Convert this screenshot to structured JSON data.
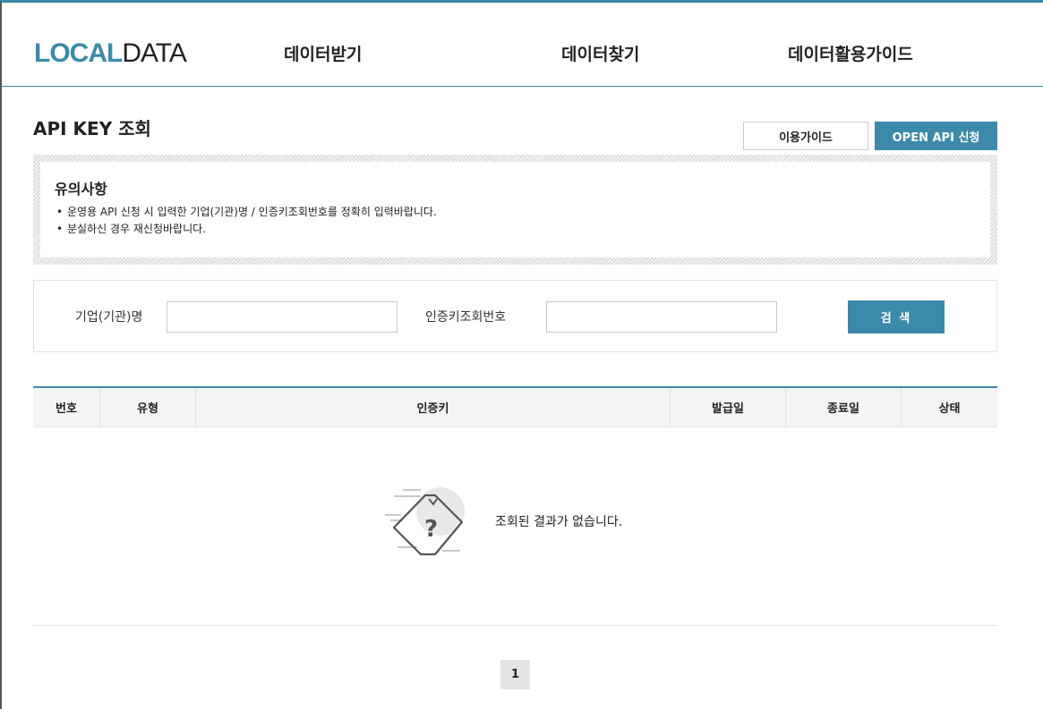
{
  "header": {
    "logo_local": "LOCAL",
    "logo_data": "DATA",
    "nav": [
      "데이터받기",
      "데이터찾기",
      "데이터활용가이드"
    ]
  },
  "page": {
    "title": "API KEY 조회",
    "guide_button": "이용가이드",
    "open_api_button": "OPEN API 신청"
  },
  "notice": {
    "title": "유의사항",
    "items": [
      "운영용 API 신청 시 입력한 기업(기관)명 / 인증키조회번호를 정확히 입력바랍니다.",
      "분실하신 경우 재신청바랍니다."
    ]
  },
  "search": {
    "company_label": "기업(기관)명",
    "company_value": "",
    "key_label": "인증키조회번호",
    "key_value": "",
    "button": "검 색"
  },
  "table": {
    "columns": [
      "번호",
      "유형",
      "인증키",
      "발급일",
      "종료일",
      "상태"
    ],
    "empty_message": "조회된 결과가 없습니다."
  },
  "pagination": {
    "current": "1"
  },
  "colors": {
    "accent": "#3d89a9"
  }
}
